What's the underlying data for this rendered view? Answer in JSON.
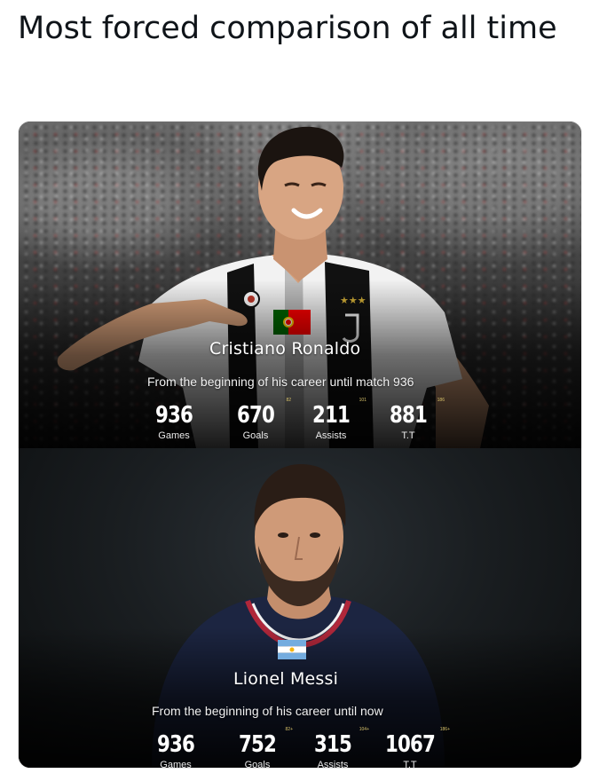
{
  "tweet": {
    "text": "Most forced comparison of all time"
  },
  "panels": [
    {
      "player_name": "Cristiano Ronaldo",
      "subtitle": "From the beginning of his career until match 936",
      "stats": [
        {
          "value": "936",
          "label": "Games",
          "note": ""
        },
        {
          "value": "670",
          "label": "Goals",
          "note": "82"
        },
        {
          "value": "211",
          "label": "Assists",
          "note": "101"
        },
        {
          "value": "881",
          "label": "T.T",
          "note": "186"
        }
      ],
      "flag": "portugal-flag"
    },
    {
      "player_name": "Lionel Messi",
      "subtitle": "From the beginning of his career until now",
      "stats": [
        {
          "value": "936",
          "label": "Games",
          "note": ""
        },
        {
          "value": "752",
          "label": "Goals",
          "note": "82+"
        },
        {
          "value": "315",
          "label": "Assists",
          "note": "104+"
        },
        {
          "value": "1067",
          "label": "T.T",
          "note": "186+"
        }
      ],
      "flag": "argentina-flag"
    }
  ],
  "colors": {
    "text": "#0f1419",
    "overlay_text": "#ffffff",
    "portugal_green": "#006600",
    "portugal_red": "#ff0000",
    "argentina_blue": "#74acdf"
  }
}
